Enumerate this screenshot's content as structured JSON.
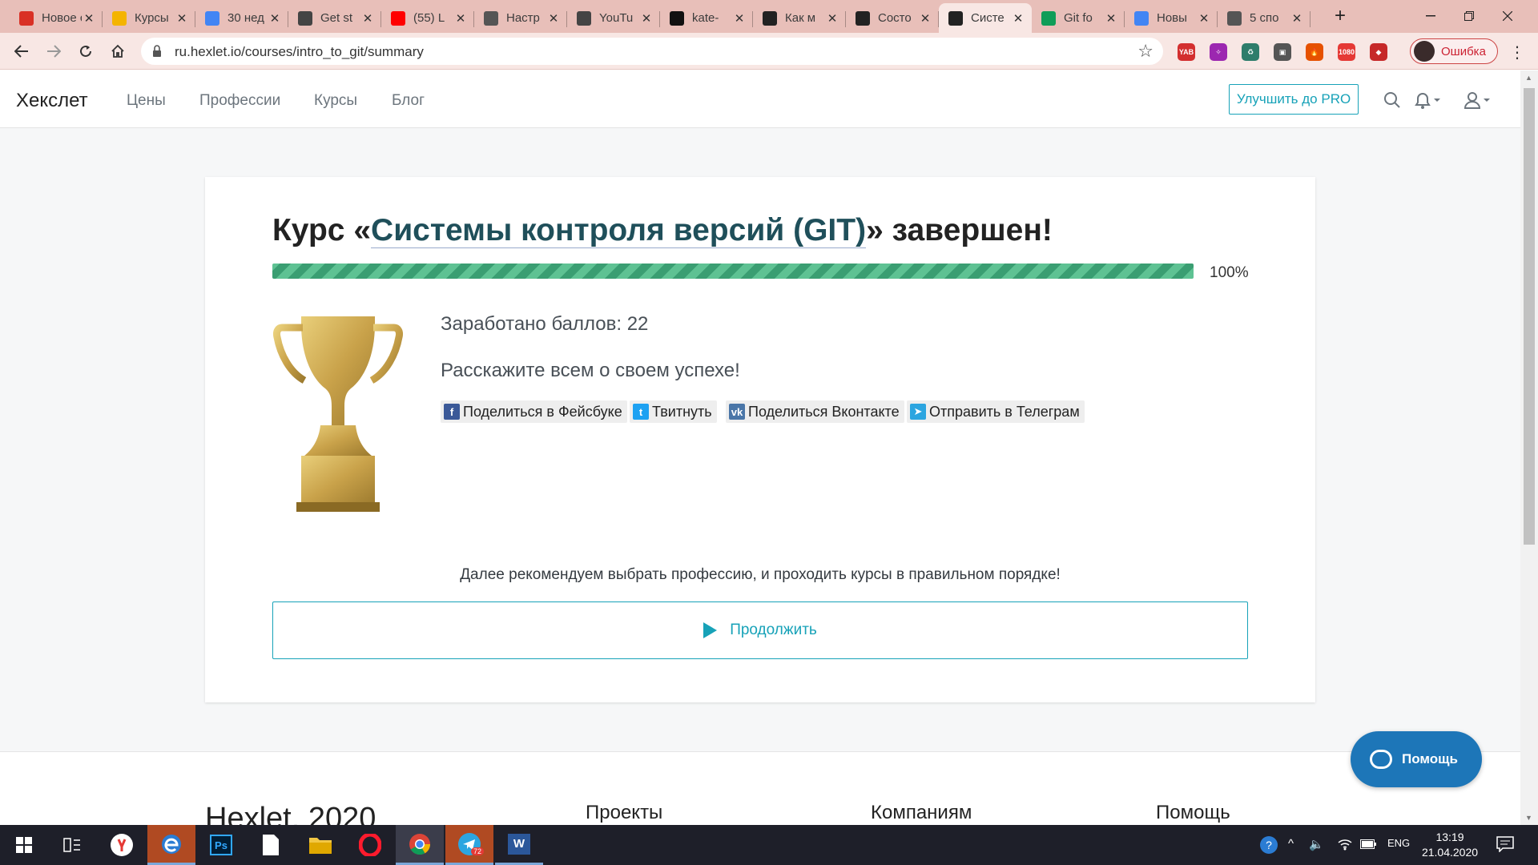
{
  "browser": {
    "tabs": [
      {
        "title": "Новое сообщение",
        "icon": "gmail-icon",
        "color": "#d93025"
      },
      {
        "title": "Курсы",
        "icon": "classroom-icon",
        "color": "#f4b400"
      },
      {
        "title": "30 нед",
        "icon": "contacts-icon",
        "color": "#4285f4"
      },
      {
        "title": "Get st",
        "icon": "globe-icon",
        "color": "#444444"
      },
      {
        "title": "(55) L",
        "icon": "youtube-icon",
        "color": "#ff0000"
      },
      {
        "title": "Настр",
        "icon": "gear-icon",
        "color": "#555555"
      },
      {
        "title": "YouTu",
        "icon": "globe-icon",
        "color": "#444444"
      },
      {
        "title": "kate-",
        "icon": "github-icon",
        "color": "#111111"
      },
      {
        "title": "Как м",
        "icon": "slash-icon",
        "color": "#222222"
      },
      {
        "title": "Состо",
        "icon": "hexlet-icon",
        "color": "#222222"
      },
      {
        "title": "Систе",
        "icon": "hexlet-icon",
        "color": "#222222",
        "active": true
      },
      {
        "title": "Git fo",
        "icon": "drive-icon",
        "color": "#0f9d58"
      },
      {
        "title": "Новы",
        "icon": "docs-icon",
        "color": "#4285f4"
      },
      {
        "title": "5 спо",
        "icon": "loading-icon",
        "color": "#555555"
      }
    ],
    "new_tab_symbol": "+",
    "close_symbol": "✕",
    "url": "ru.hexlet.io/courses/intro_to_git/summary",
    "profile_label": "Ошибка",
    "extensions": [
      {
        "name": "yandex-ext-icon",
        "label": "YAB",
        "color": "#d32f2f"
      },
      {
        "name": "sparkle-ext-icon",
        "label": "✧",
        "color": "#9c27b0"
      },
      {
        "name": "recycle-ext-icon",
        "label": "♻",
        "color": "#2e7d6b"
      },
      {
        "name": "screenshot-ext-icon",
        "label": "▣",
        "color": "#555555"
      },
      {
        "name": "fire-ext-icon",
        "label": "🔥",
        "color": "#e65100"
      },
      {
        "name": "hd-ext-icon",
        "label": "1080",
        "color": "#e53935"
      },
      {
        "name": "red-ext-icon",
        "label": "◆",
        "color": "#c62828"
      }
    ]
  },
  "site": {
    "logo": "Хекслет",
    "nav": [
      "Цены",
      "Профессии",
      "Курсы",
      "Блог"
    ],
    "pro_button": "Улучшить до PRO"
  },
  "summary": {
    "title_prefix": "Курс «",
    "course_name": "Системы контроля версий (GIT)",
    "title_suffix": "» завершен!",
    "progress_percent": 100,
    "progress_label": "100%",
    "points_text": "Заработано баллов: 22",
    "share_prompt": "Расскажите всем о своем успехе!",
    "share_buttons": [
      {
        "label": "Поделиться в Фейсбуке",
        "icon": "facebook-icon",
        "color": "#3b5998",
        "glyph": "f"
      },
      {
        "label": "Твитнуть",
        "icon": "twitter-icon",
        "color": "#1da1f2",
        "glyph": "t"
      },
      {
        "label": "Поделиться Вконтакте",
        "icon": "vk-icon",
        "color": "#4a76a8",
        "glyph": "vk"
      },
      {
        "label": "Отправить в Телеграм",
        "icon": "telegram-icon",
        "color": "#2ca5e0",
        "glyph": "➤"
      }
    ],
    "recommend_text": "Далее рекомендуем выбрать профессию, и проходить курсы в правильном порядке!",
    "continue_label": "Продолжить"
  },
  "footer": {
    "brand": "Hexlet, 2020",
    "columns": [
      "Проекты",
      "Компаниям",
      "Помощь"
    ]
  },
  "help_button": "Помощь",
  "taskbar": {
    "language": "ENG",
    "time": "13:19",
    "date": "21.04.2020",
    "telegram_badge": "72"
  },
  "colors": {
    "accent": "#17a2b8",
    "progress": "#4caf82",
    "help": "#1d76b8"
  }
}
